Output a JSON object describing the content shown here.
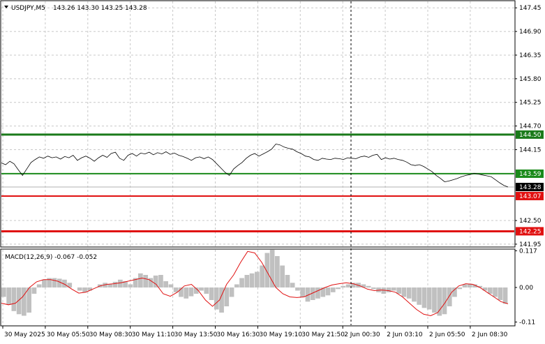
{
  "header": {
    "symbol": "USDJPY,M5",
    "ohlc": "143.26 143.30 143.25 143.28"
  },
  "macd": {
    "label": "MACD(12,26,9) -0.067 -0.052",
    "axis_ticks": [
      {
        "value": 0.117,
        "label": "0.117"
      },
      {
        "value": 0.0,
        "label": "0.00"
      },
      {
        "value": -0.11,
        "label": "-0.11"
      }
    ]
  },
  "price_axis": {
    "ticks": [
      {
        "value": 147.45,
        "label": "147.45"
      },
      {
        "value": 146.9,
        "label": "146.90"
      },
      {
        "value": 146.35,
        "label": "146.35"
      },
      {
        "value": 145.8,
        "label": "145.80"
      },
      {
        "value": 145.25,
        "label": "145.25"
      },
      {
        "value": 144.7,
        "label": "144.70"
      },
      {
        "value": 144.15,
        "label": "144.15"
      },
      {
        "value": 142.5,
        "label": "142.50"
      },
      {
        "value": 141.95,
        "label": "141.95"
      }
    ],
    "current": {
      "value": 143.28,
      "label": "143.28"
    }
  },
  "levels": [
    {
      "value": 144.5,
      "label": "144.50",
      "color": "#1a7a1a",
      "width": 3
    },
    {
      "value": 143.59,
      "label": "143.59",
      "color": "#1a8a1a",
      "width": 2
    },
    {
      "value": 143.07,
      "label": "143.07",
      "color": "#e01010",
      "width": 2
    },
    {
      "value": 142.25,
      "label": "142.25",
      "color": "#e01010",
      "width": 3
    }
  ],
  "time_axis": [
    "30 May 2025",
    "30 May 05:50",
    "30 May 08:30",
    "30 May 11:10",
    "30 May 13:50",
    "30 May 16:30",
    "30 May 19:10",
    "30 May 21:50",
    "2 Jun 00:30",
    "2 Jun 03:10",
    "2 Jun 05:50",
    "2 Jun 08:30"
  ],
  "chart_data": {
    "type": "line",
    "price_line": [
      143.84,
      143.8,
      143.88,
      143.82,
      143.68,
      143.55,
      143.7,
      143.85,
      143.92,
      143.98,
      143.95,
      144.0,
      143.96,
      143.98,
      143.93,
      143.99,
      143.96,
      144.02,
      143.9,
      143.96,
      144.0,
      143.95,
      143.88,
      143.96,
      144.02,
      143.97,
      144.06,
      144.09,
      143.95,
      143.9,
      144.02,
      144.06,
      144.0,
      144.07,
      144.05,
      144.09,
      144.03,
      144.08,
      144.05,
      144.1,
      144.04,
      144.07,
      144.02,
      143.99,
      143.95,
      143.9,
      143.96,
      143.98,
      143.94,
      143.98,
      143.92,
      143.82,
      143.72,
      143.62,
      143.55,
      143.7,
      143.78,
      143.85,
      143.95,
      144.02,
      144.06,
      144.0,
      144.05,
      144.1,
      144.16,
      144.28,
      144.26,
      144.21,
      144.18,
      144.16,
      144.1,
      144.06,
      144.0,
      143.98,
      143.92,
      143.9,
      143.95,
      143.93,
      143.92,
      143.95,
      143.94,
      143.92,
      143.96,
      143.95,
      143.94,
      143.98,
      144.0,
      143.97,
      144.02,
      144.04,
      143.92,
      143.96,
      143.93,
      143.95,
      143.92,
      143.9,
      143.86,
      143.8,
      143.78,
      143.8,
      143.76,
      143.7,
      143.64,
      143.55,
      143.48,
      143.4,
      143.42,
      143.45,
      143.48,
      143.52,
      143.55,
      143.57,
      143.6,
      143.58,
      143.56,
      143.54,
      143.52,
      143.45,
      143.38,
      143.32,
      143.28
    ],
    "macd_histogram": [
      -0.03,
      -0.055,
      -0.075,
      -0.085,
      -0.09,
      -0.08,
      -0.02,
      0.01,
      0.025,
      0.03,
      0.03,
      0.028,
      0.025,
      0.015,
      0.0,
      -0.01,
      -0.015,
      -0.01,
      0.0,
      0.01,
      0.015,
      0.01,
      0.018,
      0.025,
      0.02,
      0.01,
      0.03,
      0.045,
      0.04,
      0.03,
      0.038,
      0.04,
      0.02,
      0.01,
      -0.015,
      -0.03,
      -0.035,
      -0.028,
      -0.02,
      -0.01,
      -0.02,
      -0.04,
      -0.07,
      -0.08,
      -0.06,
      -0.03,
      0.01,
      0.03,
      0.04,
      0.045,
      0.05,
      0.07,
      0.11,
      0.12,
      0.1,
      0.07,
      0.04,
      0.015,
      -0.01,
      -0.03,
      -0.045,
      -0.04,
      -0.035,
      -0.03,
      -0.025,
      -0.015,
      -0.005,
      0.005,
      0.01,
      0.015,
      0.015,
      0.01,
      0.005,
      -0.005,
      -0.015,
      -0.02,
      -0.015,
      -0.01,
      -0.02,
      -0.03,
      -0.035,
      -0.045,
      -0.055,
      -0.065,
      -0.07,
      -0.08,
      -0.09,
      -0.085,
      -0.06,
      -0.03,
      -0.005,
      0.01,
      0.012,
      0.01,
      0.005,
      -0.01,
      -0.02,
      -0.03,
      -0.04,
      -0.052
    ],
    "macd_signal": [
      -0.05,
      -0.055,
      -0.05,
      -0.03,
      0.0,
      0.018,
      0.025,
      0.025,
      0.02,
      0.01,
      -0.005,
      -0.018,
      -0.015,
      -0.005,
      0.005,
      0.01,
      0.012,
      0.015,
      0.02,
      0.025,
      0.03,
      0.025,
      0.01,
      -0.02,
      -0.028,
      -0.015,
      0.005,
      0.01,
      -0.01,
      -0.04,
      -0.06,
      -0.04,
      0.01,
      0.04,
      0.08,
      0.115,
      0.11,
      0.08,
      0.04,
      0.0,
      -0.02,
      -0.03,
      -0.032,
      -0.03,
      -0.02,
      -0.01,
      0.0,
      0.008,
      0.012,
      0.015,
      0.012,
      0.005,
      -0.005,
      -0.01,
      -0.008,
      -0.01,
      -0.015,
      -0.03,
      -0.05,
      -0.07,
      -0.085,
      -0.09,
      -0.08,
      -0.05,
      -0.015,
      0.005,
      0.012,
      0.01,
      0.0,
      -0.015,
      -0.03,
      -0.045,
      -0.052
    ],
    "price_range": [
      141.9,
      147.6
    ],
    "macd_range": [
      -0.12,
      0.12
    ]
  }
}
